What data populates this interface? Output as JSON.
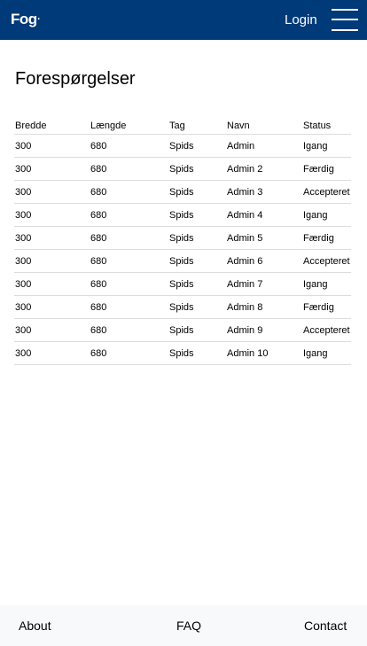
{
  "navbar": {
    "logo": "Fog",
    "login_label": "Login",
    "menu_icon": "hamburger-menu-icon",
    "background": "#003A78"
  },
  "page": {
    "title": "Forespørgelser"
  },
  "table": {
    "headers": [
      "Bredde",
      "Længde",
      "Tag",
      "Navn",
      "Status"
    ],
    "rows": [
      [
        "300",
        "680",
        "Spids",
        "Admin",
        "Igang"
      ],
      [
        "300",
        "680",
        "Spids",
        "Admin 2",
        "Færdig"
      ],
      [
        "300",
        "680",
        "Spids",
        "Admin 3",
        "Accepteret"
      ],
      [
        "300",
        "680",
        "Spids",
        "Admin 4",
        "Igang"
      ],
      [
        "300",
        "680",
        "Spids",
        "Admin 5",
        "Færdig"
      ],
      [
        "300",
        "680",
        "Spids",
        "Admin 6",
        "Accepteret"
      ],
      [
        "300",
        "680",
        "Spids",
        "Admin 7",
        "Igang"
      ],
      [
        "300",
        "680",
        "Spids",
        "Admin 8",
        "Færdig"
      ],
      [
        "300",
        "680",
        "Spids",
        "Admin 9",
        "Accepteret"
      ],
      [
        "300",
        "680",
        "Spids",
        "Admin 10",
        "Igang"
      ]
    ]
  },
  "footer": {
    "about": "About",
    "faq": "FAQ",
    "contact": "Contact"
  }
}
